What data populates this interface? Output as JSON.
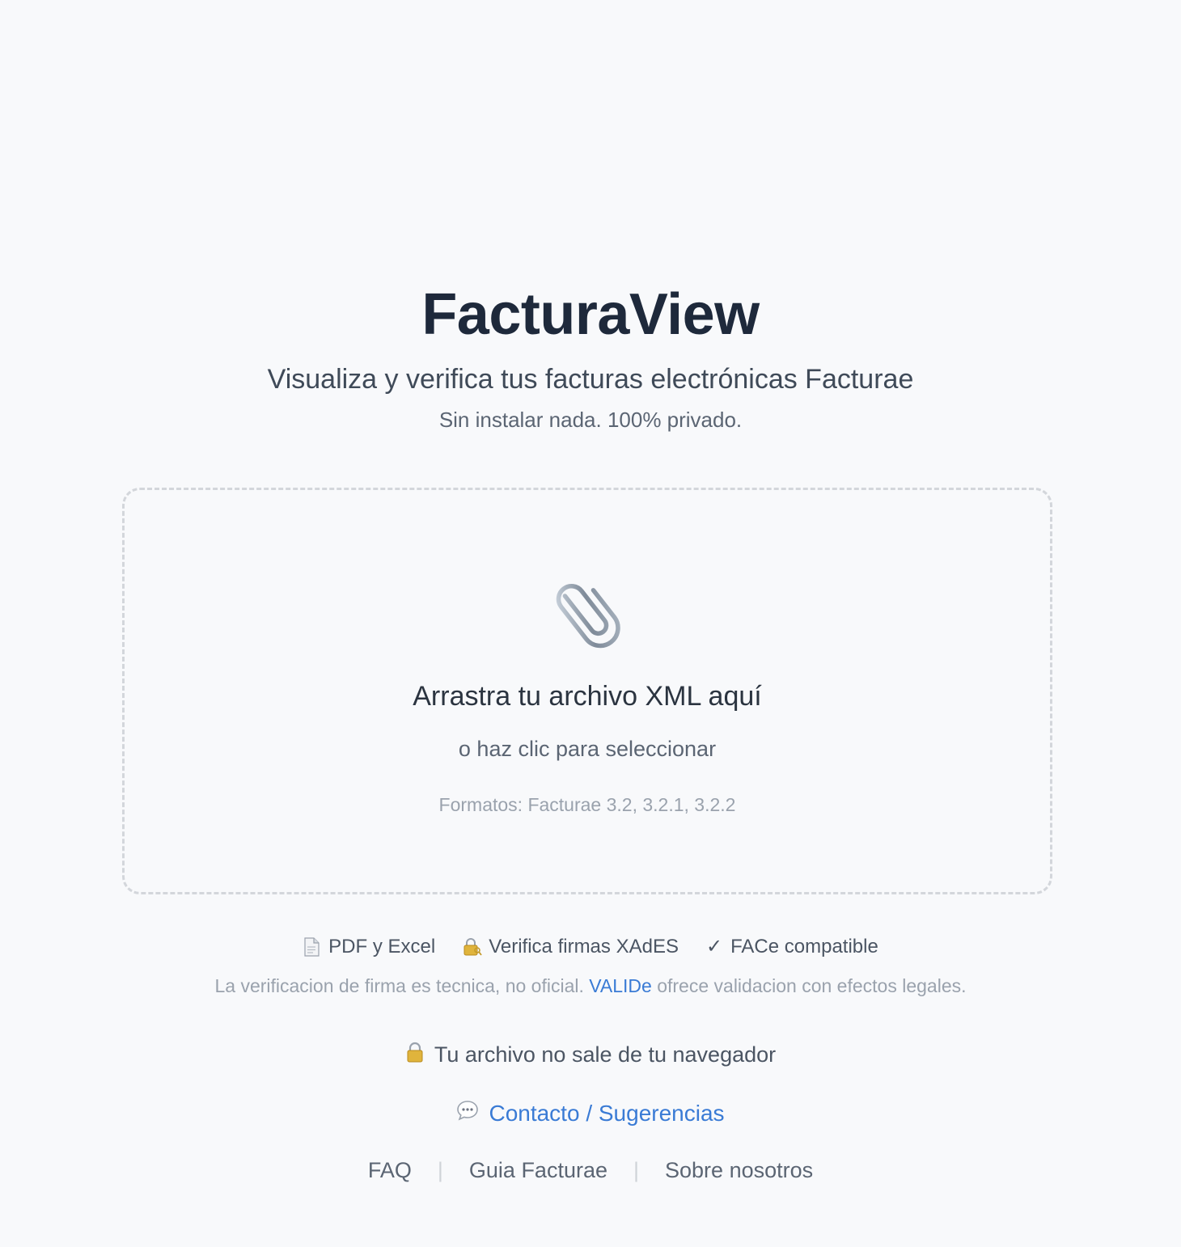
{
  "header": {
    "title": "FacturaView",
    "subtitle": "Visualiza y verifica tus facturas electrónicas Facturae",
    "tagline": "Sin instalar nada. 100% privado."
  },
  "dropzone": {
    "icon": "paperclip-icon",
    "title": "Arrastra tu archivo XML aquí",
    "subtitle": "o haz clic para seleccionar",
    "formats": "Formatos: Facturae 3.2, 3.2.1, 3.2.2"
  },
  "features": [
    {
      "icon": "document-icon",
      "label": "PDF y Excel"
    },
    {
      "icon": "lock-key-icon",
      "label": "Verifica firmas XAdES"
    },
    {
      "icon": "checkmark-icon",
      "label": "FACe compatible"
    }
  ],
  "disclaimer": {
    "before": "La verificacion de firma es tecnica, no oficial. ",
    "link": "VALIDe",
    "after": " ofrece validacion con efectos legales."
  },
  "privacy": {
    "icon": "lock-icon",
    "text": "Tu archivo no sale de tu navegador"
  },
  "contact": {
    "icon": "speech-bubble-icon",
    "label": "Contacto / Sugerencias"
  },
  "footer": {
    "links": [
      "FAQ",
      "Guia Facturae",
      "Sobre nosotros"
    ],
    "separator": "|"
  },
  "colors": {
    "background": "#f8f9fb",
    "title": "#1e293b",
    "link": "#3a7bd5",
    "muted": "#9aa2ad",
    "dropzone_border": "#d3d6db"
  }
}
